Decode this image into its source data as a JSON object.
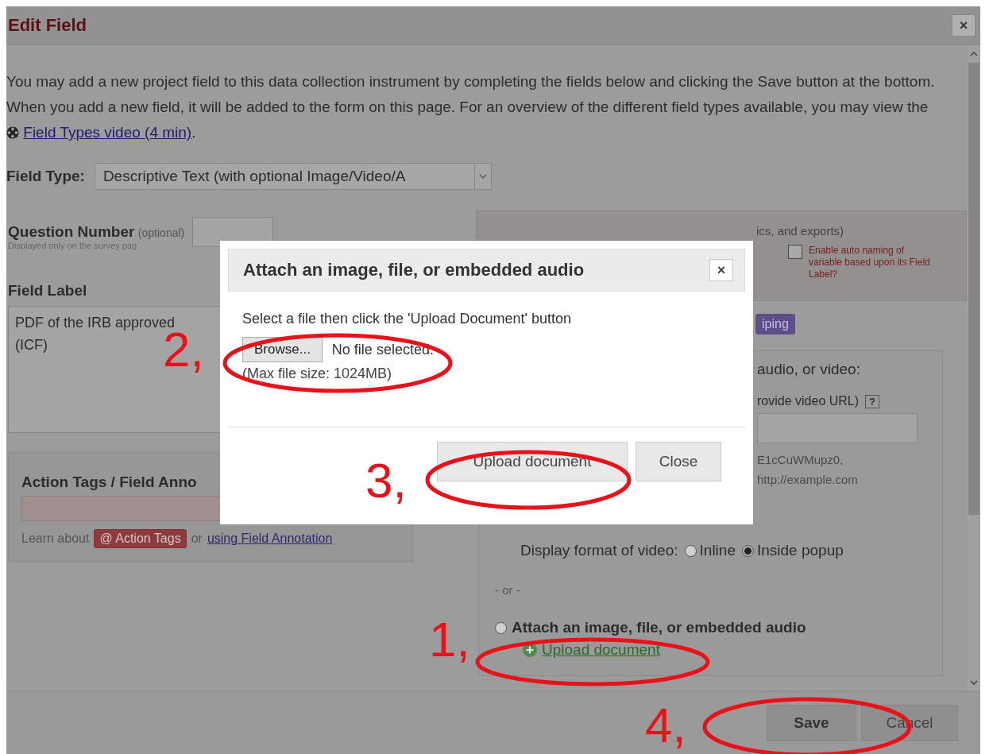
{
  "dialog": {
    "title": "Edit Field",
    "close": "×",
    "intro": {
      "before": "You may add a new project field to this data collection instrument by completing the fields below and clicking the Save button at the bottom. When you add a new field, it will be added to the form on this page. For an overview of the different field types available, you may view the ",
      "link": "Field Types video (4 min)",
      "after": "."
    }
  },
  "field_type": {
    "label": "Field Type:",
    "value": "Descriptive Text (with optional Image/Video/A"
  },
  "question_number": {
    "label": "Question Number",
    "optional": "(optional)",
    "hint": "Displayed only on the survey pag"
  },
  "field_label": {
    "label": "Field Label",
    "value_lines": [
      "PDF of the IRB approved",
      "(ICF)"
    ]
  },
  "action_tags": {
    "heading": "Action Tags / Field Anno",
    "learn": "Learn about",
    "tag_button": "@ Action Tags",
    "or": "or",
    "link": "using Field Annotation"
  },
  "variable_name": {
    "note": "ics, and exports)",
    "auto_naming": {
      "label": "Enable auto naming of variable based upon its Field Label?",
      "checked": false
    }
  },
  "piping_badge": "iping",
  "media": {
    "heading": "audio, or video:",
    "video_url_label": "rovide video URL)",
    "help": "?",
    "example_lines": [
      "E1cCuWMupz0,",
      "http://example.com"
    ],
    "display_format": {
      "label": "Display format of video:",
      "options": [
        {
          "label": "Inline",
          "selected": false
        },
        {
          "label": "Inside popup",
          "selected": true
        }
      ]
    },
    "or": "- or -",
    "attach": {
      "label": "Attach an image, file, or embedded audio",
      "selected": false
    },
    "upload_link": "Upload document"
  },
  "footer_buttons": [
    {
      "label": "Save",
      "kind": "primary"
    },
    {
      "label": "Cancel",
      "kind": "secondary"
    }
  ],
  "modal": {
    "title": "Attach an image, file, or embedded audio",
    "close": "×",
    "instruction": "Select a file then click the 'Upload Document' button",
    "browse": "Browse...",
    "no_file": "No file selected.",
    "max_size": "(Max file size: 1024MB)",
    "buttons": [
      "Upload document",
      "Close"
    ]
  },
  "annotations": [
    {
      "label": "1,"
    },
    {
      "label": "2,"
    },
    {
      "label": "3,"
    },
    {
      "label": "4,"
    }
  ]
}
